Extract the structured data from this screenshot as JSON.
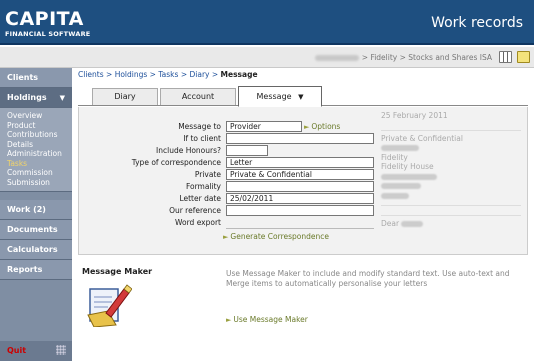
{
  "header": {
    "brand": "CAPITA",
    "brand_sub": "FINANCIAL SOFTWARE",
    "title": "Work records"
  },
  "topbar": {
    "client_path": "> Fidelity > Stocks and Shares ISA"
  },
  "sidebar": {
    "clients": "Clients",
    "holdings": "Holdings",
    "holdings_caret": "▼",
    "holdings_items": [
      "Overview",
      "Product",
      "Contributions",
      "Details",
      "Administration",
      "Tasks",
      "Commission",
      "Submission"
    ],
    "current_item": "Tasks",
    "work": "Work (2)",
    "documents": "Documents",
    "calculators": "Calculators",
    "reports": "Reports",
    "quit": "Quit"
  },
  "breadcrumb": {
    "clients": "Clients",
    "holdings": "Holdings",
    "tasks": "Tasks",
    "diary": "Diary",
    "current": "Message"
  },
  "tabs": {
    "diary": "Diary",
    "account": "Account",
    "message": "Message",
    "message_caret": "▼"
  },
  "form": {
    "message_to_label": "Message to",
    "message_to_value": "Provider",
    "options_link": "Options",
    "if_to_client_label": "If to client",
    "include_honours_label": "Include Honours?",
    "type_label": "Type of correspondence",
    "type_value": "Letter",
    "private_label": "Private",
    "private_value": "Private & Confidential",
    "formality_label": "Formality",
    "letter_date_label": "Letter date",
    "letter_date_value": "25/02/2011",
    "our_reference_label": "Our reference",
    "word_export_label": "Word export",
    "generate_link": "Generate Correspondence"
  },
  "preview": {
    "date": "25 February 2011",
    "confidential": "Private & Confidential",
    "company": "Fidelity",
    "house": "Fidelity House",
    "dear": "Dear"
  },
  "message_maker": {
    "title": "Message Maker",
    "text": "Use Message Maker to include and modify standard text. Use auto-text and Merge items to automatically personalise your letters",
    "link": "Use Message Maker"
  },
  "colors": {
    "header_bg": "#1e4f80",
    "sidebar_bg": "#7f8ea3",
    "link_green": "#6a7a2a",
    "current_nav": "#f2d46a",
    "quit_red": "#cc0000"
  }
}
